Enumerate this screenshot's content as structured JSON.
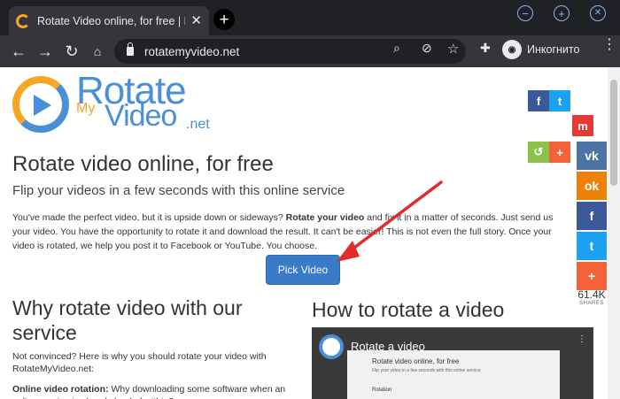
{
  "browser": {
    "tab_title": "Rotate Video online, for free | Rotate",
    "tab_close": "✕",
    "new_tab": "+",
    "url": "rotatemyvideo.net",
    "profile_label": "Инкогнито",
    "win_min": "−",
    "win_max": "+",
    "win_close": "✕",
    "back": "←",
    "forward": "→",
    "reload": "↻",
    "zoom": "⌕",
    "eye_off": "⊘",
    "star": "☆",
    "ext": "✚",
    "menu": "⋮"
  },
  "logo": {
    "line1": "Rotate",
    "line2": "My",
    "line3": "Video",
    "line4": ".net"
  },
  "page": {
    "title": "Rotate video online, for free",
    "subtitle": "Flip your videos in a few seconds with this online service",
    "intro_1": "You've made the perfect video, but it is upside down or sideways?",
    "intro_bold": "Rotate your video",
    "intro_2": "and fix it in a matter of seconds. Just send us your video. You have the opportunity to rotate it and download the result. It can't be easier! This is not even the full story. Once your video is rotated, we help you post it to Facebook or YouTube. You choose.",
    "pick_button": "Pick Video",
    "why_title": "Why rotate video with our service",
    "why_text": "Not convinced? Here is why you should rotate your video with RotateMyVideo.net:",
    "online_label": "Online video rotation:",
    "online_text": "Why downloading some software when an online service is already loaded within?",
    "how_title": "How to rotate a video"
  },
  "video": {
    "title": "Rotate a video",
    "shot_title": "Rotate video online, for free",
    "shot_sub": "Flip your video in a few seconds with this online service",
    "shot_rotation": "Rotation",
    "menu": "⋮"
  },
  "share": {
    "count": "61.4K",
    "label": "SHARES",
    "f": "f",
    "t": "t",
    "plus": "+",
    "vk": "vk",
    "ok": "ok",
    "mix": "m"
  },
  "colors": {
    "facebook": "#3b5998",
    "twitter": "#1da1f2",
    "vk": "#4c75a3",
    "ok": "#ee8208",
    "plus": "#f4623a",
    "mix": "#ff8226",
    "button": "#3a7bc8",
    "arrow": "#e32b2b"
  }
}
